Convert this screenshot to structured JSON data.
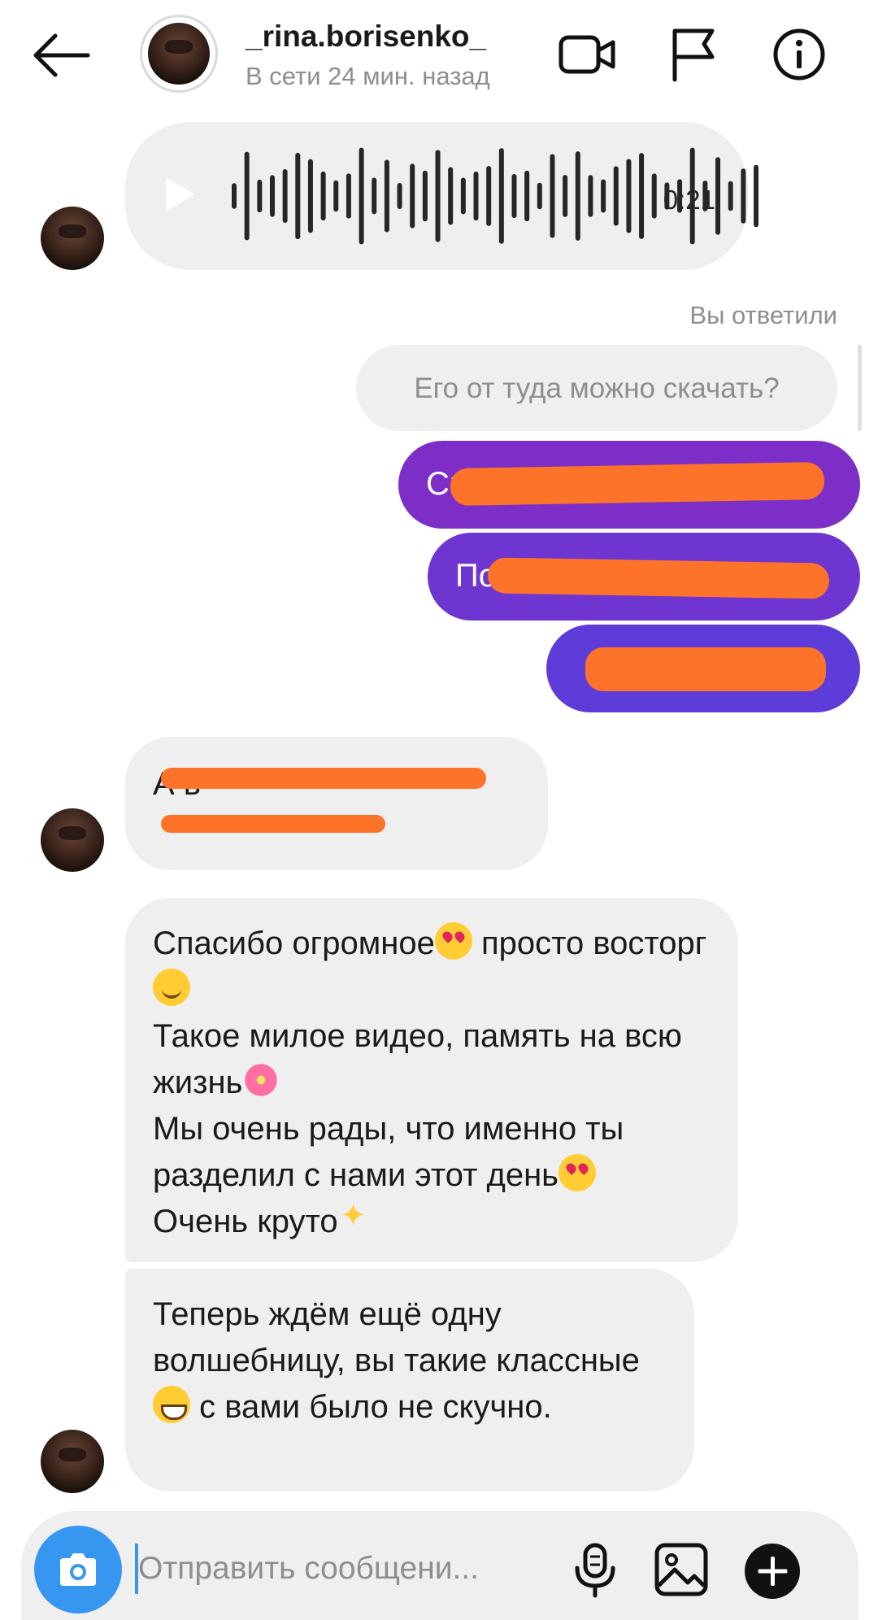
{
  "header": {
    "username": "_rina.borisenko_",
    "status": "В сети 24 мин. назад",
    "icons": [
      "back-arrow-icon",
      "video-call-icon",
      "flag-icon",
      "info-icon"
    ]
  },
  "messages": {
    "voice": {
      "duration": "0:21"
    },
    "reply_label": "Вы ответили",
    "reply_quote": "Его от туда можно скачать?",
    "out1": "Ск",
    "out2": "По",
    "out3": "",
    "in1": "А в",
    "in2_parts": {
      "p1": "Спасибо огромное",
      "p2": " просто восторг",
      "p3": "Такое милое видео, память на всю жизнь",
      "p4": "Мы очень рады, что именно ты разделил с нами этот день",
      "p5": "Очень круто"
    },
    "in3_parts": {
      "p1": "Теперь ждём ещё одну волшебницу, вы такие классные ",
      "p2": " с вами было не скучно."
    }
  },
  "composer": {
    "placeholder": "Отправить сообщени..."
  },
  "colors": {
    "accent": "#3797f0",
    "bubble_in": "#efefef",
    "bubble_out_1": "#7c2ec7",
    "bubble_out_2": "#6e35d0",
    "bubble_out_3": "#5e3cd9",
    "redaction": "#fd7329"
  }
}
